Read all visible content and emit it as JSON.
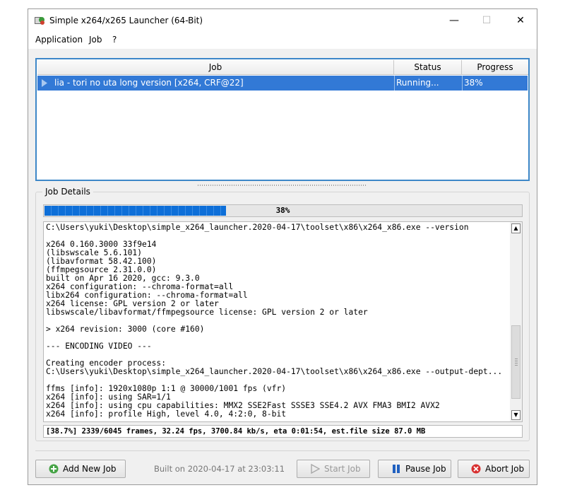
{
  "window": {
    "title": "Simple x264/x265 Launcher (64-Bit)",
    "controls": {
      "minimize": "—",
      "maximize": "☐",
      "close": "✕"
    }
  },
  "menu": {
    "items": [
      "Application",
      "Job",
      "?"
    ]
  },
  "job_table": {
    "columns": [
      "Job",
      "Status",
      "Progress"
    ],
    "rows": [
      {
        "job": "lia - tori no uta long version [x264, CRF@22]",
        "status": "Running...",
        "progress": "38%"
      }
    ],
    "selection_color": "#3279d6"
  },
  "details": {
    "legend": "Job Details",
    "progress": {
      "fraction": 0.38,
      "label": "38%",
      "color": "#0e6fd8"
    },
    "log": [
      "C:\\Users\\yuki\\Desktop\\simple_x264_launcher.2020-04-17\\toolset\\x86\\x264_x86.exe --version",
      "",
      "x264 0.160.3000 33f9e14",
      "(libswscale 5.6.101)",
      "(libavformat 58.42.100)",
      "(ffmpegsource 2.31.0.0)",
      "built on Apr 16 2020, gcc: 9.3.0",
      "x264 configuration: --chroma-format=all",
      "libx264 configuration: --chroma-format=all",
      "x264 license: GPL version 2 or later",
      "libswscale/libavformat/ffmpegsource license: GPL version 2 or later",
      "",
      "> x264 revision: 3000 (core #160)",
      "",
      "--- ENCODING VIDEO ---",
      "",
      "Creating encoder process:",
      "C:\\Users\\yuki\\Desktop\\simple_x264_launcher.2020-04-17\\toolset\\x86\\x264_x86.exe --output-dept...",
      "",
      "ffms [info]: 1920x1080p 1:1 @ 30000/1001 fps (vfr)",
      "x264 [info]: using SAR=1/1",
      "x264 [info]: using cpu capabilities: MMX2 SSE2Fast SSSE3 SSE4.2 AVX FMA3 BMI2 AVX2",
      "x264 [info]: profile High, level 4.0, 4:2:0, 8-bit"
    ],
    "status_line": "[38.7%] 2339/6045 frames, 32.24 fps, 3700.84 kb/s, eta 0:01:54, est.file size 87.0 MB"
  },
  "footer": {
    "add_job": "Add New Job",
    "built_on": "Built on 2020-04-17 at 23:03:11",
    "start_job": "Start Job",
    "pause_job": "Pause Job",
    "abort_job": "Abort Job"
  }
}
